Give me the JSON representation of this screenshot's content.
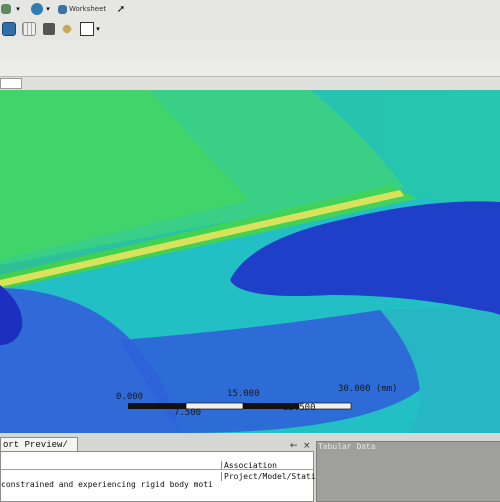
{
  "toolbar": {
    "worksheet_label": "Worksheet",
    "icons": [
      "window-icon",
      "dropdown-icon",
      "globe-icon",
      "dropdown-icon",
      "worksheet-icon",
      "cursor-icon",
      "save-icon",
      "grid-icon",
      "camera-icon",
      "tag-icon",
      "rectangle-select-icon",
      "dropdown-icon"
    ]
  },
  "scale_bar": {
    "ticks_top": [
      "0.000",
      "15.000",
      "30.000 (mm)"
    ],
    "ticks_bottom": [
      "7.500",
      "22.500"
    ]
  },
  "report_preview": {
    "tab_label": "ort Preview/",
    "message_text": "constrained and experiencing rigid body moti",
    "association_header": "Association",
    "association_value": "Project/Model/Static"
  },
  "tabular_data": {
    "tab_label": "Tabular Data"
  },
  "pane_controls": {
    "pin_glyph": "←",
    "close_glyph": "×"
  },
  "colors": {
    "deep_blue": "#1f33c9",
    "blue": "#2f62d8",
    "cyan": "#27b6a4",
    "teal": "#25c7aa",
    "green": "#3fd35f",
    "yellow_band": "#d9e25a"
  }
}
